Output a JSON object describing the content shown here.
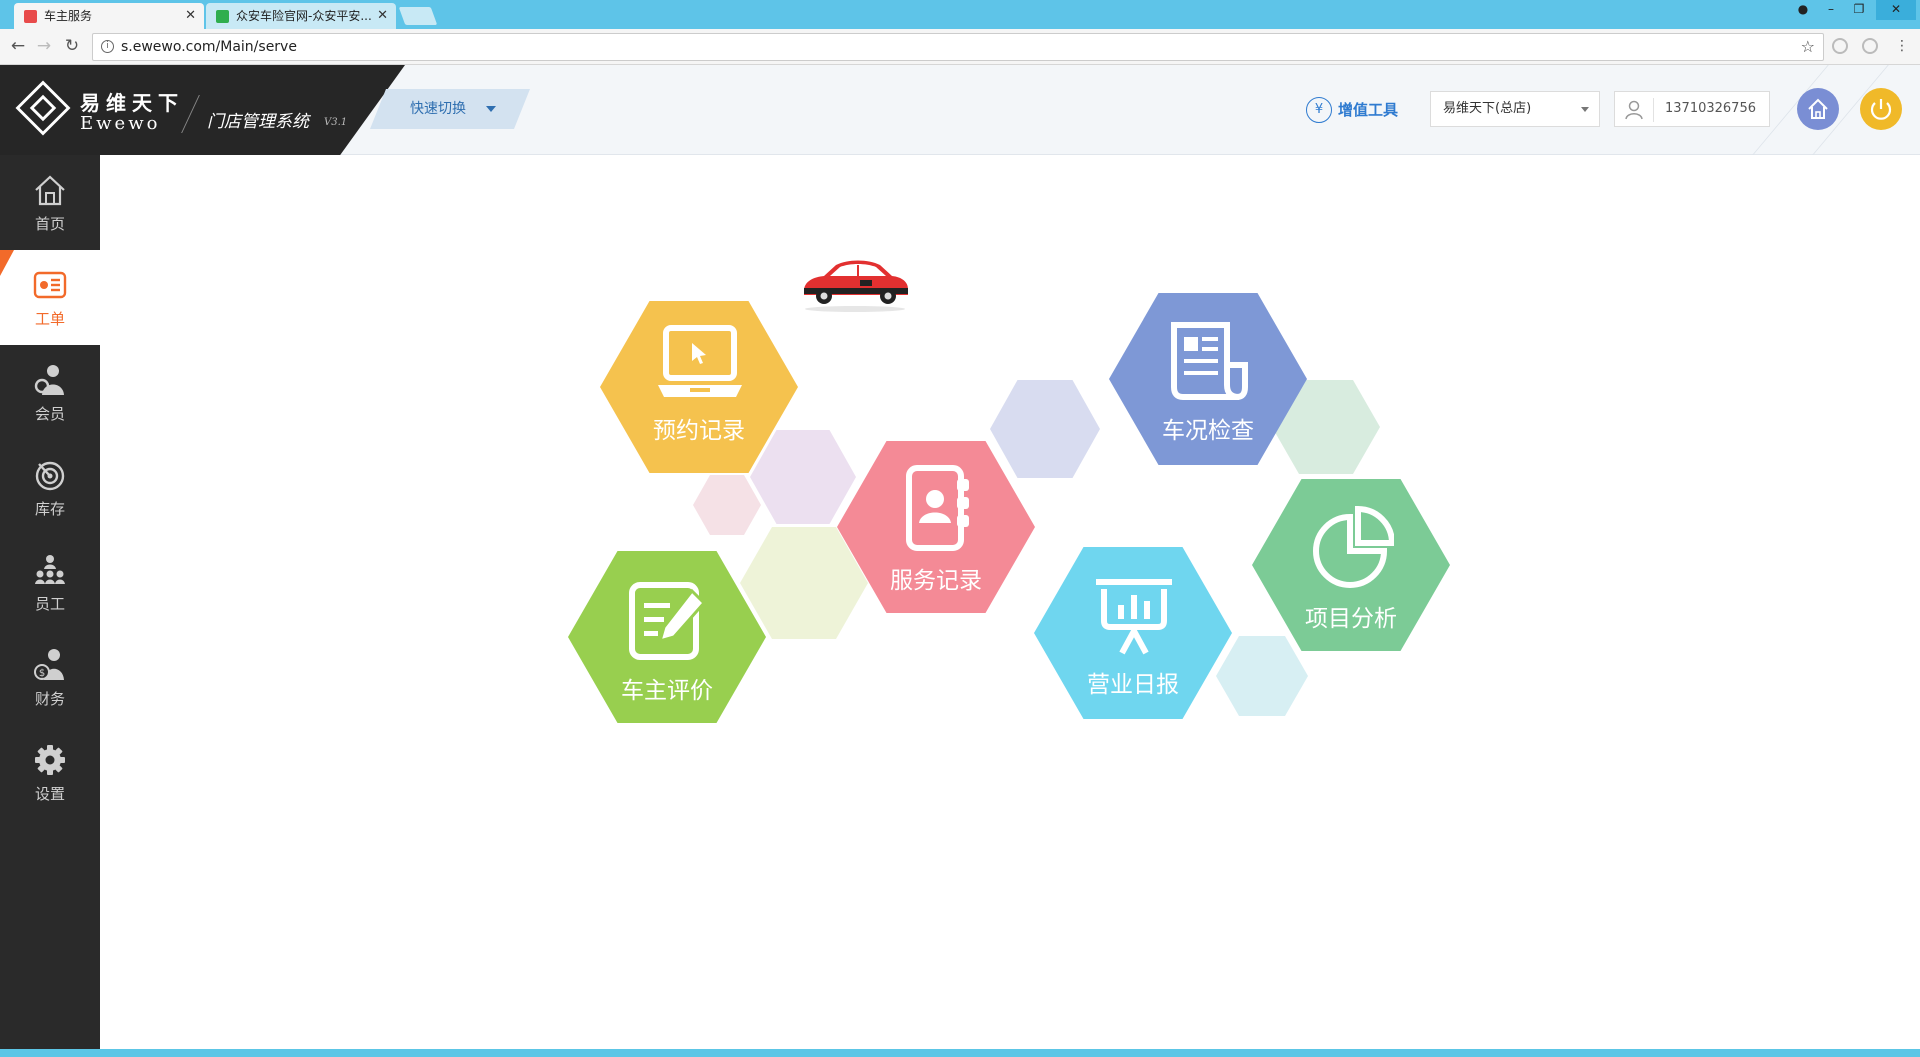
{
  "browser": {
    "tabs": [
      {
        "title": "车主服务",
        "active": true
      },
      {
        "title": "众安车险官网-众安平安...",
        "active": false
      }
    ],
    "url": "s.ewewo.com/Main/serve"
  },
  "header": {
    "logo_cn": "易维天下",
    "logo_en": "Ewewo",
    "system_name": "门店管理系统",
    "version": "V3.1",
    "quick_switch": "快速切换",
    "value_added_tools": "增值工具",
    "store_select": "易维天下(总店)",
    "user_phone": "13710326756"
  },
  "sidebar": {
    "items": [
      {
        "label": "首页",
        "icon": "home-icon"
      },
      {
        "label": "工单",
        "icon": "work-order-icon",
        "active": true
      },
      {
        "label": "会员",
        "icon": "member-icon"
      },
      {
        "label": "库存",
        "icon": "inventory-icon"
      },
      {
        "label": "员工",
        "icon": "staff-icon"
      },
      {
        "label": "财务",
        "icon": "finance-icon"
      },
      {
        "label": "设置",
        "icon": "settings-icon"
      }
    ]
  },
  "tiles": [
    {
      "label": "预约记录",
      "color": "#f5c24e",
      "icon": "laptop-icon"
    },
    {
      "label": "服务记录",
      "color": "#f48a96",
      "icon": "contacts-book-icon"
    },
    {
      "label": "车况检查",
      "color": "#7e98d6",
      "icon": "report-icon"
    },
    {
      "label": "车主评价",
      "color": "#98cf4f",
      "icon": "edit-icon"
    },
    {
      "label": "营业日报",
      "color": "#6fd6ef",
      "icon": "presentation-icon"
    },
    {
      "label": "项目分析",
      "color": "#7ccb96",
      "icon": "pie-chart-icon"
    }
  ],
  "colors": {
    "accent": "#f26a2a",
    "brand_blue": "#2f7bd0",
    "sidebar_bg": "#2a2a2a"
  }
}
